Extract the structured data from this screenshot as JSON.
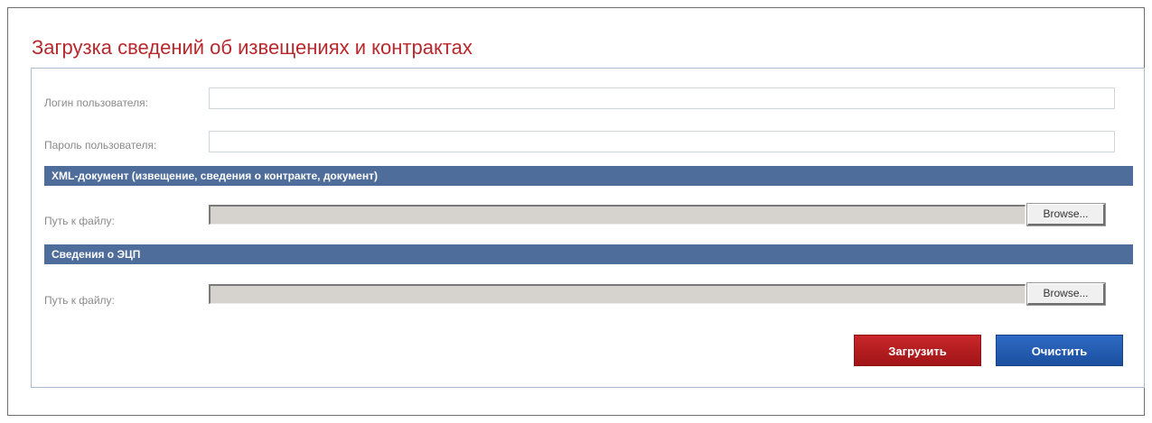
{
  "page": {
    "title": "Загрузка сведений об извещениях и контрактах"
  },
  "form": {
    "login_label": "Логин пользователя:",
    "login_value": "",
    "password_label": "Пароль пользователя:",
    "password_value": ""
  },
  "sections": [
    {
      "header": "XML-документ (извещение, сведения о контракте, документ)",
      "path_label": "Путь к файлу:",
      "path_value": "",
      "browse_label": "Browse..."
    },
    {
      "header": "Сведения о ЭЦП",
      "path_label": "Путь к файлу:",
      "path_value": "",
      "browse_label": "Browse..."
    }
  ],
  "actions": {
    "upload_label": "Загрузить",
    "clear_label": "Очистить"
  },
  "colors": {
    "title": "#b8292e",
    "section_header_bg": "#4e6d9a",
    "upload_button": "#b51d20",
    "clear_button": "#2360b8"
  }
}
